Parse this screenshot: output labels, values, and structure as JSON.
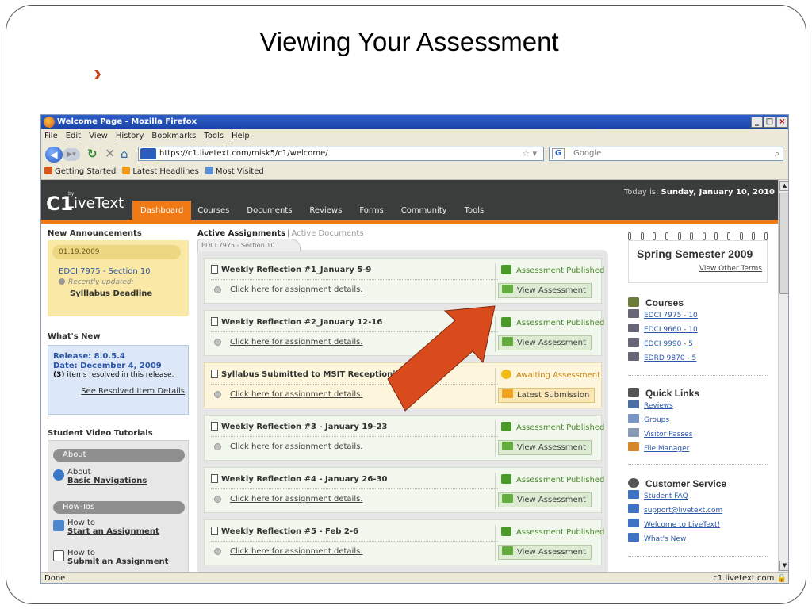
{
  "slide": {
    "title": "Viewing Your Assessment"
  },
  "browser": {
    "window_title": "Welcome Page - Mozilla Firefox",
    "window_buttons": [
      "_",
      "□",
      "×"
    ],
    "menu": [
      "File",
      "Edit",
      "View",
      "History",
      "Bookmarks",
      "Tools",
      "Help"
    ],
    "url": "https://c1.livetext.com/misk5/c1/welcome/",
    "search_placeholder": "Google",
    "bookmarks": [
      "Getting Started",
      "Latest Headlines",
      "Most Visited"
    ],
    "status_left": "Done",
    "status_right": "c1.livetext.com"
  },
  "site": {
    "logo": "LiveText",
    "logo_c1": "C1",
    "logo_by": "by",
    "today_label": "Today is:",
    "today_date": "Sunday, January 10, 2010",
    "tabs": [
      "Dashboard",
      "Courses",
      "Documents",
      "Reviews",
      "Forms",
      "Community",
      "Tools"
    ],
    "active_tab": "Dashboard"
  },
  "announcements": {
    "title": "New Announcements",
    "date": "01.19.2009",
    "course": "EDCI 7975 - Section 10",
    "updated": "Recently updated:",
    "item": "Sylllabus Deadline"
  },
  "whats_new": {
    "title": "What's New",
    "release": "Release: 8.0.5.4",
    "date": "Date: December 4, 2009",
    "items_count": "(3)",
    "items_text": "items resolved in this release.",
    "link": "See Resolved Item Details"
  },
  "tutorials": {
    "title": "Student Video Tutorials",
    "about_header": "About",
    "about_l1": "About",
    "about_l2": "Basic Navigations",
    "howtos_header": "How-Tos",
    "howto1_l1": "How to",
    "howto1_l2": "Start an Assignment",
    "howto2_l1": "How to",
    "howto2_l2": "Submit an Assignment"
  },
  "assignments": {
    "header_active": "Active Assignments",
    "header_sep": "|",
    "header_docs": "Active Documents",
    "section_tab": "EDCI 7975 - Section 10",
    "cards": [
      {
        "title": "Weekly Reflection #1_January 5-9",
        "link": "Click here for assignment details.",
        "status": "Assessment Published",
        "button": "View Assessment",
        "waiting": false
      },
      {
        "title": "Weekly Reflection #2_January 12-16",
        "link": "Click here for assignment details.",
        "status": "Assessment Published",
        "button": "View Assessment",
        "waiting": false
      },
      {
        "title": "Syllabus Submitted to MSIT Receptionist",
        "link": "Click here for assignment details.",
        "status": "Awaiting Assessment",
        "button": "Latest Submission",
        "waiting": true
      },
      {
        "title": "Weekly Reflection #3 - January 19-23",
        "link": "Click here for assignment details.",
        "status": "Assessment Published",
        "button": "View Assessment",
        "waiting": false
      },
      {
        "title": "Weekly Reflection #4 - January 26-30",
        "link": "Click here for assignment details.",
        "status": "Assessment Published",
        "button": "View Assessment",
        "waiting": false
      },
      {
        "title": "Weekly Reflection #5 - Feb 2-6",
        "link": "Click here for assignment details.",
        "status": "Assessment Published",
        "button": "View Assessment",
        "waiting": false
      }
    ]
  },
  "sidebar_right": {
    "semester": "Spring Semester 2009",
    "other_terms": "View Other Terms",
    "courses_title": "Courses",
    "courses": [
      "EDCI 7975 - 10",
      "EDCI 9660 - 10",
      "EDCI 9990 - 5",
      "EDRD 9870 - 5"
    ],
    "quick_title": "Quick Links",
    "quick": [
      "Reviews",
      "Groups",
      "Visitor Passes",
      "File Manager"
    ],
    "service_title": "Customer Service",
    "service": [
      "Student FAQ",
      "support@livetext.com",
      "Welcome to LiveText!",
      "What's New"
    ]
  },
  "colors": {
    "accent_orange": "#f07b16",
    "header_dark": "#3b3d3c",
    "arrow_red": "#d94a1c"
  }
}
